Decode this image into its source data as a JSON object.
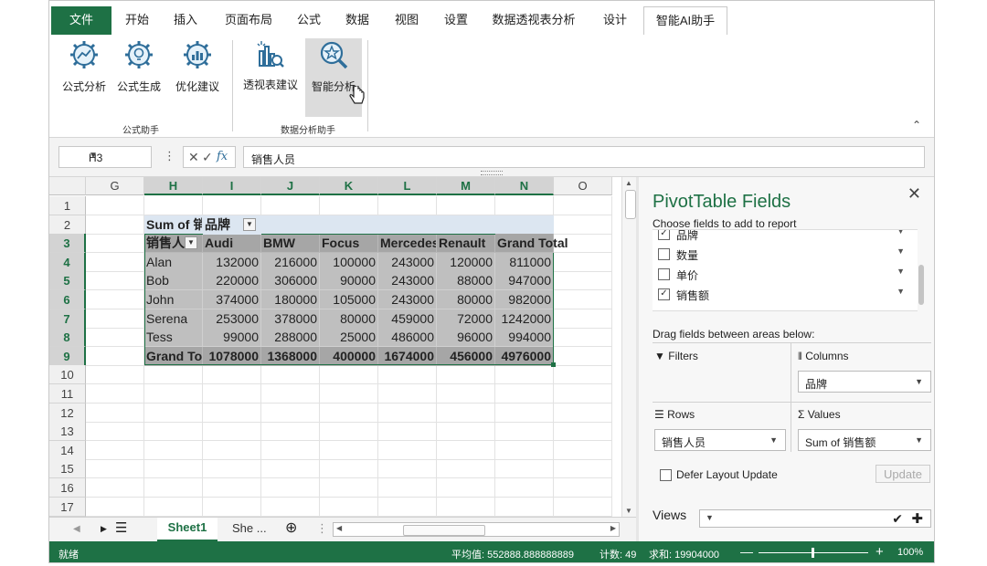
{
  "ribbon_tabs": [
    "文件",
    "开始",
    "插入",
    "页面布局",
    "公式",
    "数据",
    "视图",
    "设置",
    "数据透视表分析",
    "设计",
    "智能AI助手"
  ],
  "ribbon_groups": {
    "formula": {
      "label": "公式助手",
      "buttons": [
        "公式分析",
        "公式生成",
        "优化建议"
      ]
    },
    "data": {
      "label": "数据分析助手",
      "buttons": [
        "透视表建议",
        "智能分析"
      ]
    }
  },
  "formula_bar": {
    "name_box": "H3",
    "fx": "fx",
    "value": "销售人员"
  },
  "columns": [
    "G",
    "H",
    "I",
    "J",
    "K",
    "L",
    "M",
    "N",
    "O"
  ],
  "rows": [
    "1",
    "2",
    "3",
    "4",
    "5",
    "6",
    "7",
    "8",
    "9",
    "10",
    "11",
    "12",
    "13",
    "14",
    "15",
    "16",
    "17"
  ],
  "pivot": {
    "title": "Sum of 销售额",
    "col_field": "品牌",
    "row_field": "销售人员",
    "headers": [
      "Audi",
      "BMW",
      "Focus",
      "Mercedes",
      "Renault",
      "Grand Total"
    ],
    "data": [
      {
        "name": "Alan",
        "values": [
          "132000",
          "216000",
          "100000",
          "243000",
          "120000",
          "811000"
        ]
      },
      {
        "name": "Bob",
        "values": [
          "220000",
          "306000",
          "90000",
          "243000",
          "88000",
          "947000"
        ]
      },
      {
        "name": "John",
        "values": [
          "374000",
          "180000",
          "105000",
          "243000",
          "80000",
          "982000"
        ]
      },
      {
        "name": "Serena",
        "values": [
          "253000",
          "378000",
          "80000",
          "459000",
          "72000",
          "1242000"
        ]
      },
      {
        "name": "Tess",
        "values": [
          "99000",
          "288000",
          "25000",
          "486000",
          "96000",
          "994000"
        ]
      }
    ],
    "grand_total": {
      "name": "Grand Total",
      "values": [
        "1078000",
        "1368000",
        "400000",
        "1674000",
        "456000",
        "4976000"
      ]
    }
  },
  "sheets": [
    "Sheet1",
    "She ..."
  ],
  "pivot_panel": {
    "title": "PivotTable Fields",
    "subtitle": "Choose fields to add to report",
    "fields": [
      {
        "label": "品牌",
        "checked": true
      },
      {
        "label": "数量",
        "checked": false
      },
      {
        "label": "单价",
        "checked": false
      },
      {
        "label": "销售额",
        "checked": true
      }
    ],
    "drag_label": "Drag fields between areas below:",
    "filters": "Filters",
    "columns": "Columns",
    "columns_value": "品牌",
    "rows": "Rows",
    "rows_value": "销售人员",
    "values": "Values",
    "values_value": "Sum of 销售额",
    "defer": "Defer Layout Update",
    "update": "Update",
    "views": "Views"
  },
  "status": {
    "ready": "就绪",
    "average": "平均值: 552888.888888889",
    "count": "计数: 49",
    "sum": "求和: 19904000",
    "zoom": "100%"
  },
  "colors": {
    "accent": "#1e7145",
    "pivot_body": "#bfbfbf",
    "pivot_header": "#a6a6a6",
    "pivot_title": "#dce6f1"
  }
}
